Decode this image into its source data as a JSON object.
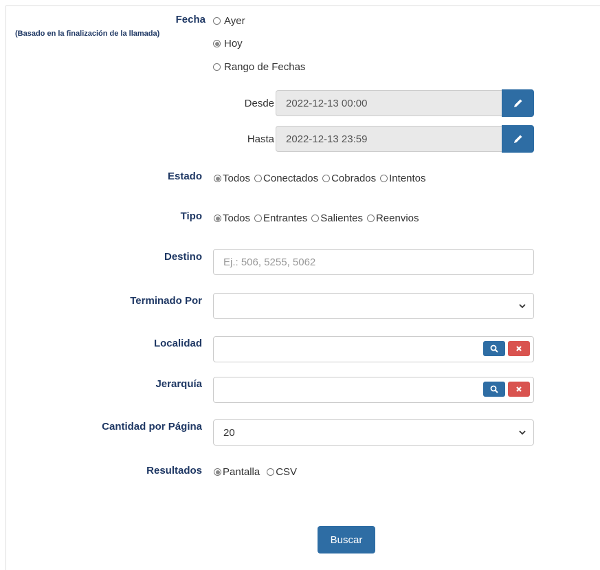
{
  "fecha": {
    "label": "Fecha",
    "sublabel": "(Basado en la finalización de la llamada)",
    "options": [
      "Ayer",
      "Hoy",
      "Rango de Fechas"
    ],
    "selected": "Hoy"
  },
  "desde": {
    "label": "Desde",
    "value": "2022-12-13 00:00"
  },
  "hasta": {
    "label": "Hasta",
    "value": "2022-12-13 23:59"
  },
  "estado": {
    "label": "Estado",
    "options": [
      "Todos",
      "Conectados",
      "Cobrados",
      "Intentos"
    ],
    "selected": "Todos"
  },
  "tipo": {
    "label": "Tipo",
    "options": [
      "Todos",
      "Entrantes",
      "Salientes",
      "Reenvios"
    ],
    "selected": "Todos"
  },
  "destino": {
    "label": "Destino",
    "placeholder": "Ej.: 506, 5255, 5062",
    "value": ""
  },
  "terminado_por": {
    "label": "Terminado Por",
    "value": ""
  },
  "localidad": {
    "label": "Localidad",
    "value": ""
  },
  "jerarquia": {
    "label": "Jerarquía",
    "value": ""
  },
  "cantidad": {
    "label": "Cantidad por Página",
    "value": "20"
  },
  "resultados": {
    "label": "Resultados",
    "options": [
      "Pantalla",
      "CSV"
    ],
    "selected": "Pantalla"
  },
  "buscar_label": "Buscar",
  "colors": {
    "label": "#1f3864",
    "primary": "#2e6da4",
    "danger": "#d9534f"
  }
}
